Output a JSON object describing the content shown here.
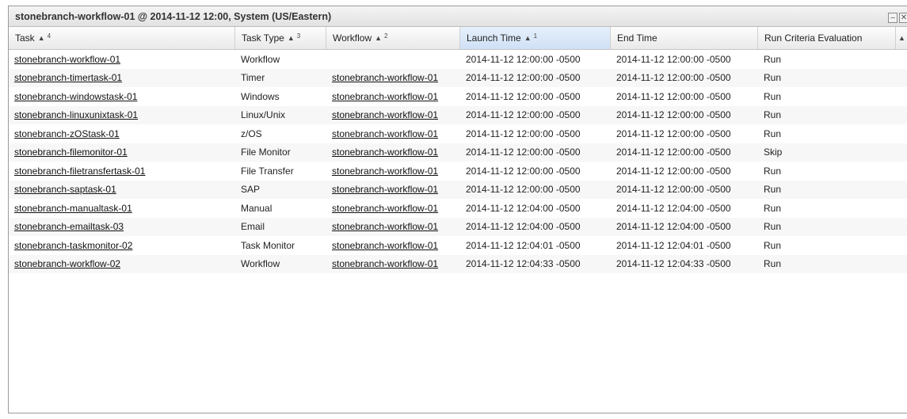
{
  "window": {
    "title": "stonebranch-workflow-01 @ 2014-11-12 12:00, System (US/Eastern)",
    "minimize_glyph": "–",
    "close_glyph": "✕"
  },
  "columns": [
    {
      "label": "Task",
      "sort": "▲",
      "rank": "4"
    },
    {
      "label": "Task Type",
      "sort": "▲",
      "rank": "3"
    },
    {
      "label": "Workflow",
      "sort": "▲",
      "rank": "2"
    },
    {
      "label": "Launch Time",
      "sort": "▲",
      "rank": "1"
    },
    {
      "label": "End Time",
      "sort": "",
      "rank": ""
    },
    {
      "label": "Run Criteria Evaluation",
      "sort": "",
      "rank": ""
    }
  ],
  "scroll_glyph": "▲",
  "rows": [
    {
      "task": "stonebranch-workflow-01",
      "type": "Workflow",
      "workflow": "",
      "launch": "2014-11-12 12:00:00 -0500",
      "end": "2014-11-12 12:00:00 -0500",
      "eval": "Run"
    },
    {
      "task": "stonebranch-timertask-01",
      "type": "Timer",
      "workflow": "stonebranch-workflow-01",
      "launch": "2014-11-12 12:00:00 -0500",
      "end": "2014-11-12 12:00:00 -0500",
      "eval": "Run"
    },
    {
      "task": "stonebranch-windowstask-01",
      "type": "Windows",
      "workflow": "stonebranch-workflow-01",
      "launch": "2014-11-12 12:00:00 -0500",
      "end": "2014-11-12 12:00:00 -0500",
      "eval": "Run"
    },
    {
      "task": "stonebranch-linuxunixtask-01",
      "type": "Linux/Unix",
      "workflow": "stonebranch-workflow-01",
      "launch": "2014-11-12 12:00:00 -0500",
      "end": "2014-11-12 12:00:00 -0500",
      "eval": "Run"
    },
    {
      "task": "stonebranch-zOStask-01",
      "type": "z/OS",
      "workflow": "stonebranch-workflow-01",
      "launch": "2014-11-12 12:00:00 -0500",
      "end": "2014-11-12 12:00:00 -0500",
      "eval": "Run"
    },
    {
      "task": "stonebranch-filemonitor-01",
      "type": "File Monitor",
      "workflow": "stonebranch-workflow-01",
      "launch": "2014-11-12 12:00:00 -0500",
      "end": "2014-11-12 12:00:00 -0500",
      "eval": "Skip"
    },
    {
      "task": "stonebranch-filetransfertask-01",
      "type": "File Transfer",
      "workflow": "stonebranch-workflow-01",
      "launch": "2014-11-12 12:00:00 -0500",
      "end": "2014-11-12 12:00:00 -0500",
      "eval": "Run"
    },
    {
      "task": "stonebranch-saptask-01",
      "type": "SAP",
      "workflow": "stonebranch-workflow-01",
      "launch": "2014-11-12 12:00:00 -0500",
      "end": "2014-11-12 12:00:00 -0500",
      "eval": "Run"
    },
    {
      "task": "stonebranch-manualtask-01",
      "type": "Manual",
      "workflow": "stonebranch-workflow-01",
      "launch": "2014-11-12 12:04:00 -0500",
      "end": "2014-11-12 12:04:00 -0500",
      "eval": "Run"
    },
    {
      "task": "stonebranch-emailtask-03",
      "type": "Email",
      "workflow": "stonebranch-workflow-01",
      "launch": "2014-11-12 12:04:00 -0500",
      "end": "2014-11-12 12:04:00 -0500",
      "eval": "Run"
    },
    {
      "task": "stonebranch-taskmonitor-02",
      "type": "Task Monitor",
      "workflow": "stonebranch-workflow-01",
      "launch": "2014-11-12 12:04:01 -0500",
      "end": "2014-11-12 12:04:01 -0500",
      "eval": "Run"
    },
    {
      "task": "stonebranch-workflow-02",
      "type": "Workflow",
      "workflow": "stonebranch-workflow-01",
      "launch": "2014-11-12 12:04:33 -0500",
      "end": "2014-11-12 12:04:33 -0500",
      "eval": "Run"
    }
  ]
}
